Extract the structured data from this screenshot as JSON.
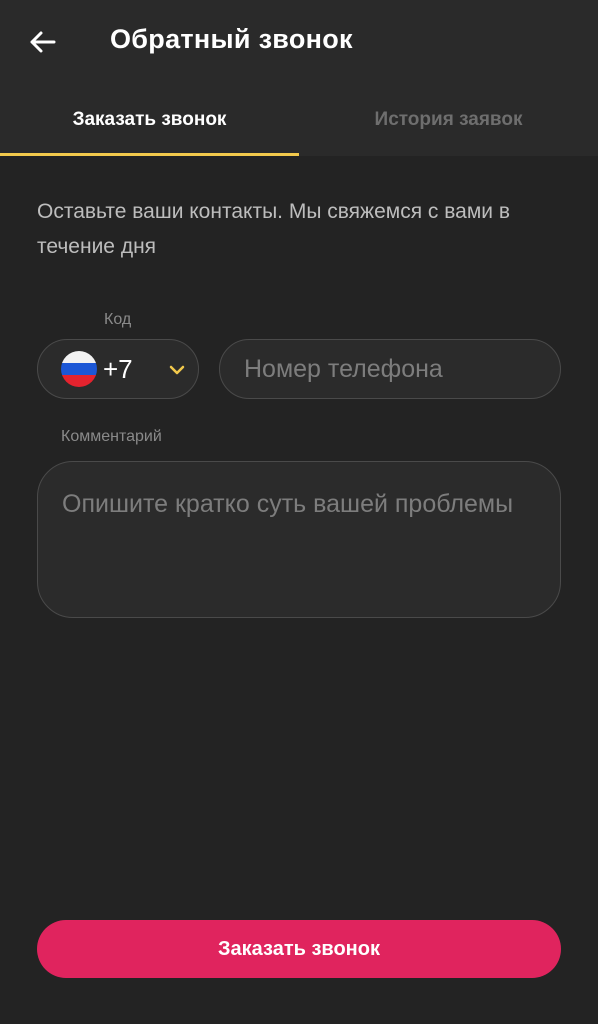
{
  "header": {
    "title": "Обратный звонок",
    "back_icon": "arrow-left-icon"
  },
  "tabs": [
    {
      "label": "Заказать звонок",
      "active": true
    },
    {
      "label": "История заявок",
      "active": false
    }
  ],
  "intro_text": "Оставьте ваши контакты. Мы свяжемся с вами в течение дня",
  "form": {
    "code_label": "Код",
    "country_code": "+7",
    "country_flag": "russia-flag-icon",
    "phone_placeholder": "Номер телефона",
    "phone_value": "",
    "comment_label": "Комментарий",
    "comment_placeholder": "Опишите кратко суть вашей проблемы",
    "comment_value": ""
  },
  "submit_label": "Заказать звонок",
  "colors": {
    "background": "#232323",
    "accent_tab": "#f2c94c",
    "button": "#e0245e"
  }
}
